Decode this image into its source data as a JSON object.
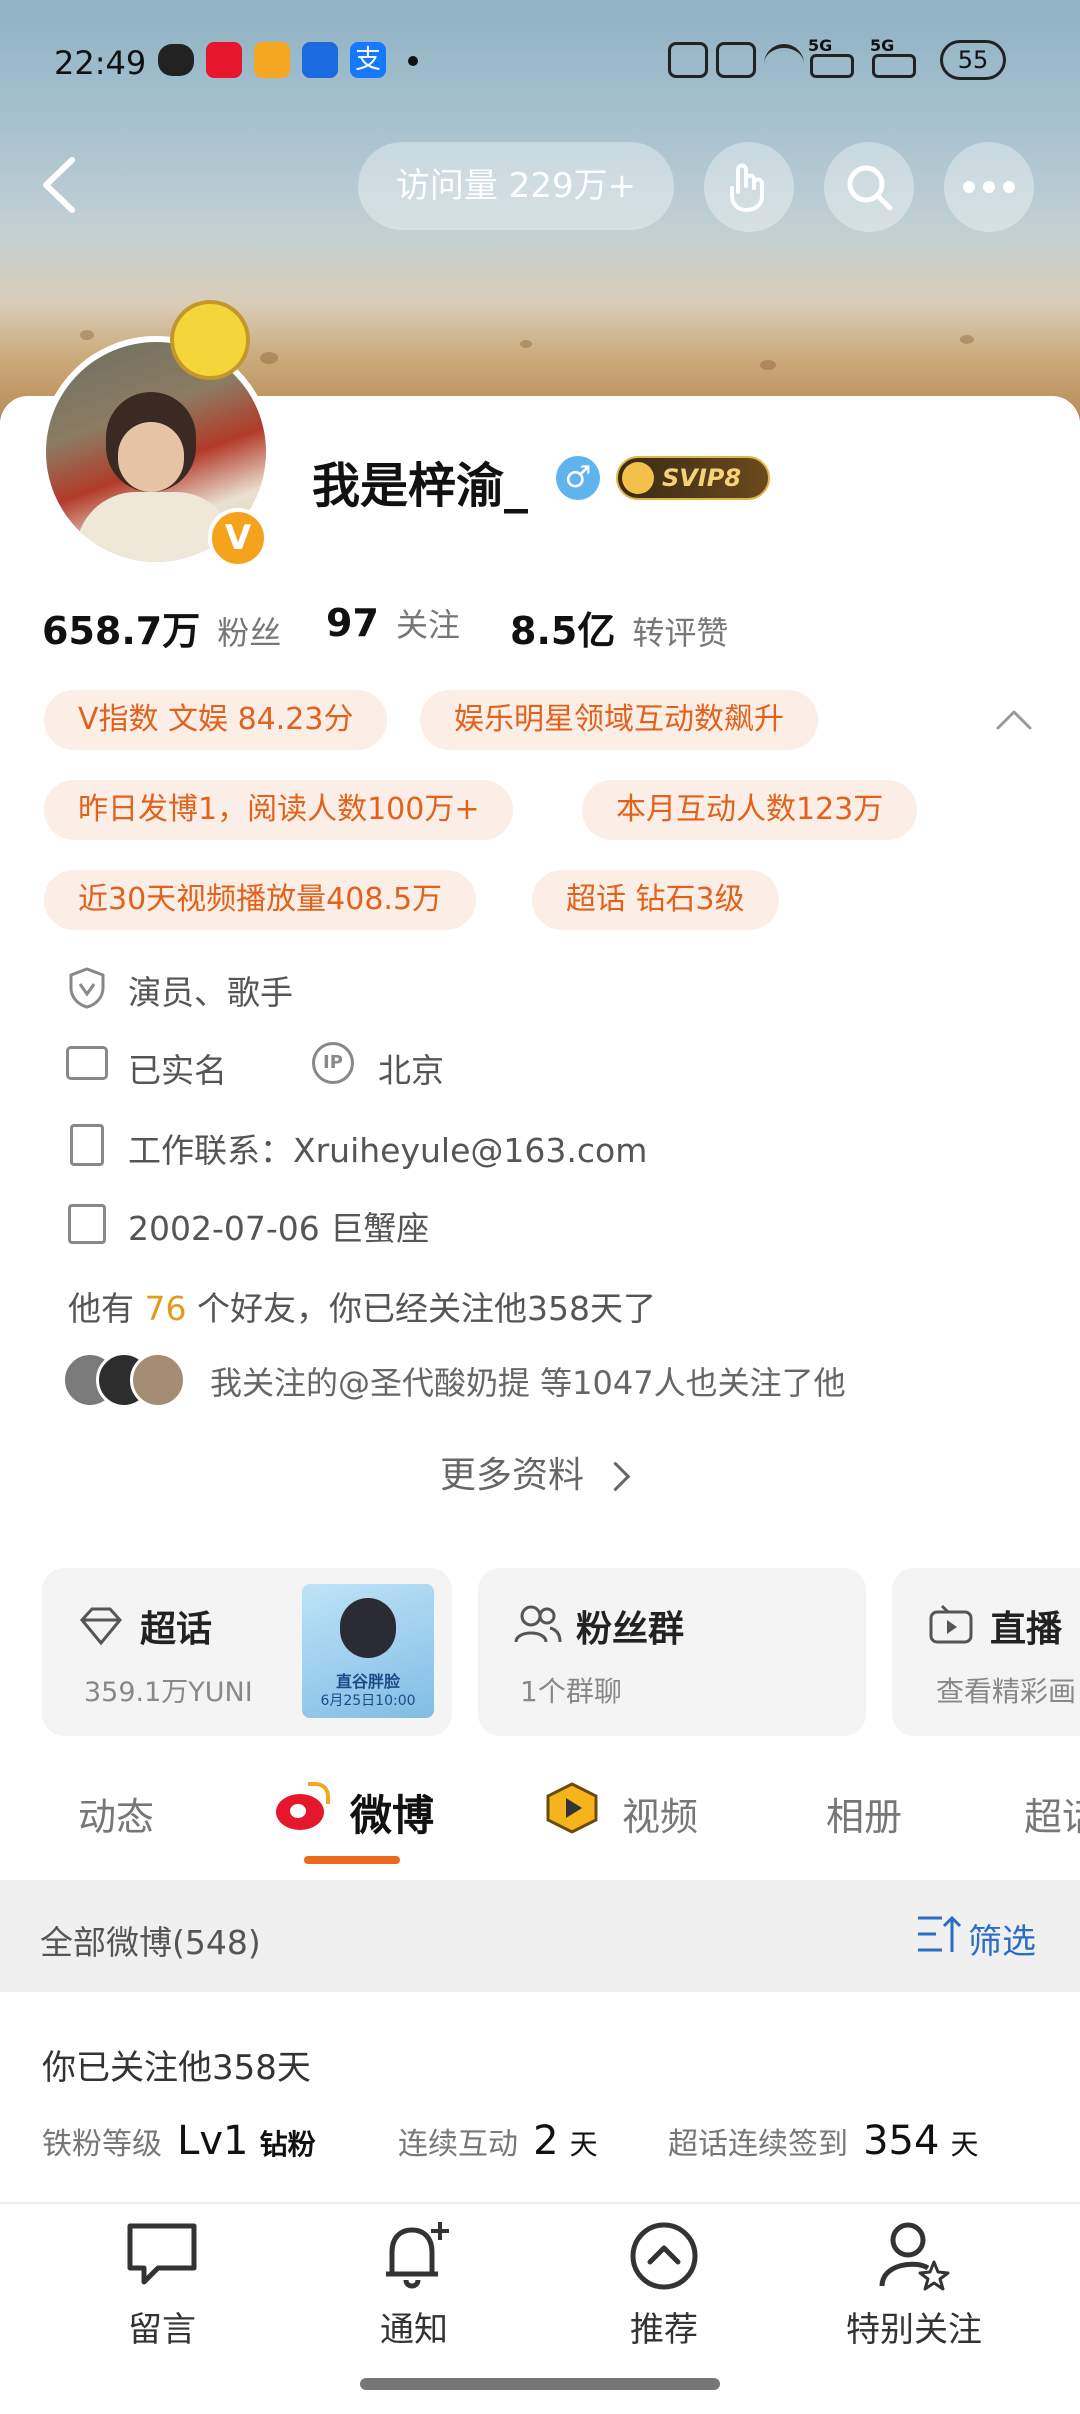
{
  "status_bar": {
    "time": "22:49",
    "network": "5G",
    "network2": "5G",
    "battery": "55",
    "app_icons": [
      "wechat-icon",
      "weibo-icon",
      "news-icon",
      "app-icon",
      "alipay-icon"
    ]
  },
  "top_bar": {
    "visits": "访问量 229万+"
  },
  "profile": {
    "name": "我是梓渝_",
    "gender_symbol": "♂",
    "vip_badge": "SVIP8",
    "verified_mark": "V",
    "stats": [
      {
        "value": "658.7万",
        "label": "粉丝"
      },
      {
        "value": "97",
        "label": "关注"
      },
      {
        "value": "8.5亿",
        "label": "转评赞"
      }
    ],
    "tags": [
      "V指数 文娱 84.23分",
      "娱乐明星领域互动数飙升",
      "昨日发博1，阅读人数100万+",
      "本月互动人数123万",
      "近30天视频播放量408.5万",
      "超话 钻石3级"
    ],
    "occupation": "演员、歌手",
    "realname": "已实名",
    "ip": "北京",
    "ip_badge": "IP",
    "contact": "工作联系：Xruiheyule@163.com",
    "birthday": "2002-07-06 巨蟹座",
    "friends_prefix": "他有",
    "friends_count": "76",
    "friends_suffix": "个好友，你已经关注他358天了",
    "mutual": "我关注的@圣代酸奶提 等1047人也关注了他",
    "more": "更多资料"
  },
  "feature_cards": [
    {
      "title": "超话",
      "sub": "359.1万YUNI"
    },
    {
      "title": "粉丝群",
      "sub": "1个群聊"
    },
    {
      "title": "直播",
      "sub": "查看精彩画"
    }
  ],
  "supertopic_thumb": {
    "line1": "直谷胖脸",
    "line2": "6月25日10:00"
  },
  "tabs": [
    "动态",
    "微博",
    "视频",
    "相册",
    "超话"
  ],
  "filter_bar": {
    "label": "全部微博(548)",
    "action": "筛选"
  },
  "fan_info": {
    "follow_days": "你已关注他358天",
    "level_label": "铁粉等级",
    "level_value": "Lv1",
    "level_tag": "钻粉",
    "interact_label": "连续互动",
    "interact_value": "2",
    "interact_unit": "天",
    "checkin_label": "超话连续签到",
    "checkin_value": "354",
    "checkin_unit": "天"
  },
  "bottom_nav": [
    "留言",
    "通知",
    "推荐",
    "特别关注"
  ],
  "colors": {
    "accent": "#e2621b",
    "pill_bg": "#fbeee6",
    "tab_underline": "#ec6a1c",
    "friends_count": "#e59a1b",
    "link_blue": "#2d6ec2"
  }
}
